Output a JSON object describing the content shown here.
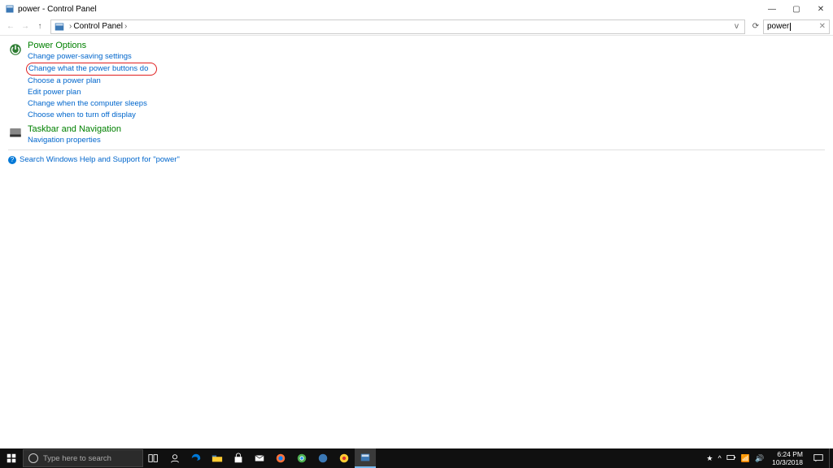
{
  "window": {
    "title": "power - Control Panel",
    "min": "—",
    "max": "▢",
    "close": "✕"
  },
  "addr": {
    "back": "←",
    "fwd": "→",
    "up": "↑",
    "breadcrumb": "Control Panel",
    "sep": "›",
    "drop": "v",
    "refresh": "⟳",
    "search_value": "power",
    "clear_x": "✕"
  },
  "results": {
    "group1_title": "Power Options",
    "group1_links": {
      "l0": "Change power-saving settings",
      "l1": "Change what the power buttons do",
      "l2": "Choose a power plan",
      "l3": "Edit power plan",
      "l4": "Change when the computer sleeps",
      "l5": "Choose when to turn off display"
    },
    "group2_title": "Taskbar and Navigation",
    "group2_links": {
      "l0": "Navigation properties"
    }
  },
  "help": {
    "label": "Search Windows Help and Support for \"power\""
  },
  "taskbar": {
    "search_placeholder": "Type here to search",
    "systray": {
      "up": "^",
      "net": "📶",
      "vol": "🔊"
    },
    "time": "6:24 PM",
    "date": "10/3/2018"
  }
}
